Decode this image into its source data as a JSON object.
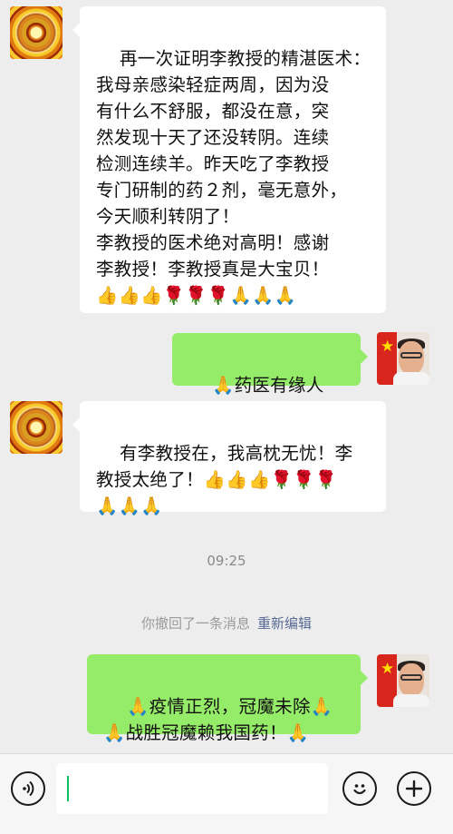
{
  "messages": [
    {
      "side": "left",
      "avatar": "mandala-avatar",
      "text": "再一次证明李教授的精湛医术：\n我母亲感染轻症两周，因为没\n有什么不舒服，都没在意，突\n然发现十天了还没转阴。连续\n检测连续羊。昨天吃了李教授\n专门研制的药２剂，毫无意外，\n今天顺利转阴了！\n李教授的医术绝对高明！感谢\n李教授！李教授真是大宝贝！\n👍👍👍🌹🌹🌹🙏🙏🙏"
    },
    {
      "side": "right",
      "avatar": "man-avatar",
      "text": "🙏药医有缘人🙏"
    },
    {
      "side": "left",
      "avatar": "mandala-avatar",
      "text": "有李教授在，我高枕无忧！李\n教授太绝了！👍👍👍🌹🌹🌹\n🙏🙏🙏"
    },
    {
      "side": "right",
      "avatar": "man-avatar",
      "text": "🙏疫情正烈，冠魔未除🙏\n🙏战胜冠魔赖我国药！🙏"
    }
  ],
  "timestamp": "09:25",
  "recall": {
    "notice": "你撤回了一条消息",
    "reedit": "重新编辑"
  },
  "input": {
    "value": ""
  },
  "icons": {
    "voice": "voice-icon",
    "emoji": "emoji-icon",
    "more": "plus-icon"
  },
  "colors": {
    "chat_background": "#ededed",
    "sent_bubble": "#95ec69",
    "received_bubble": "#ffffff",
    "link": "#586b94"
  }
}
